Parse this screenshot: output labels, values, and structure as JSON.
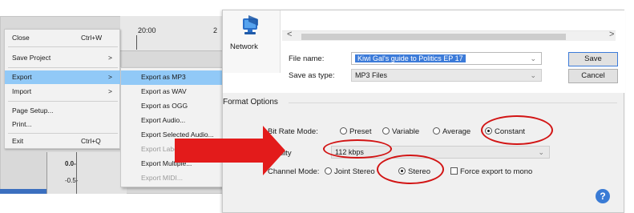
{
  "timeline": {
    "tick_label": "20:00",
    "tick_label_2": "2"
  },
  "track": {
    "ruler_top": "0.0-",
    "ruler_bottom": "-0.5-"
  },
  "file_menu": {
    "items": [
      {
        "label": "Close",
        "shortcut": "Ctrl+W",
        "arrow": ""
      },
      {
        "label": "Save Project",
        "shortcut": "",
        "arrow": ">"
      },
      {
        "label": "Export",
        "shortcut": "",
        "arrow": ">",
        "highlighted": true
      },
      {
        "label": "Import",
        "shortcut": "",
        "arrow": ">"
      },
      {
        "label": "Page Setup...",
        "shortcut": "",
        "arrow": ""
      },
      {
        "label": "Print...",
        "shortcut": "",
        "arrow": ""
      },
      {
        "label": "Exit",
        "shortcut": "Ctrl+Q",
        "arrow": ""
      }
    ]
  },
  "export_submenu": {
    "items": [
      {
        "label": "Export as MP3",
        "highlighted": true
      },
      {
        "label": "Export as WAV"
      },
      {
        "label": "Export as OGG"
      },
      {
        "label": "Export Audio..."
      },
      {
        "label": "Export Selected Audio..."
      },
      {
        "label": "Export Labels",
        "disabled": true
      },
      {
        "label": "Export Multiple..."
      },
      {
        "label": "Export MIDI...",
        "disabled": true
      }
    ]
  },
  "dialog": {
    "nav": {
      "network_label": "Network",
      "icon": "network-icon"
    },
    "scroll_left": "<",
    "scroll_right": ">",
    "file_name_label": "File name:",
    "file_name_value": "Kiwi Gal's guide to Politics EP 17",
    "save_as_type_label": "Save as type:",
    "save_as_type_value": "MP3 Files",
    "save_button": "Save",
    "cancel_button": "Cancel",
    "format_options_label": "Format Options",
    "bit_rate_mode_label": "Bit Rate Mode:",
    "bit_rate_options": [
      "Preset",
      "Variable",
      "Average",
      "Constant"
    ],
    "bit_rate_selected": "Constant",
    "quality_label": "Quality",
    "quality_value": "112 kbps",
    "channel_mode_label": "Channel Mode:",
    "channel_options": [
      "Joint Stereo",
      "Stereo"
    ],
    "channel_selected": "Stereo",
    "force_mono_label": "Force export to mono",
    "force_mono_checked": false,
    "help_glyph": "?"
  },
  "annotations": {
    "color": "#d21414"
  }
}
